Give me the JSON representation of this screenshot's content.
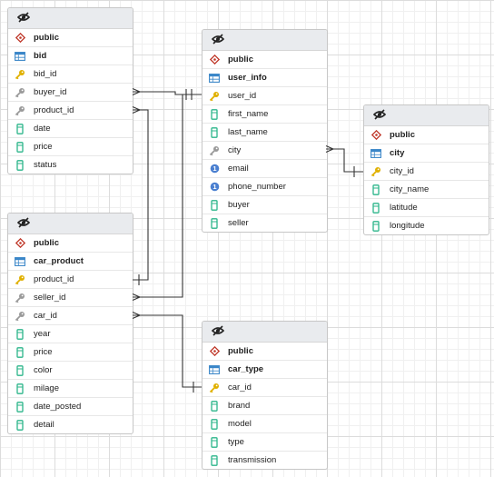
{
  "tables": {
    "bid": {
      "schema": "public",
      "name": "bid",
      "columns": [
        {
          "name": "bid_id",
          "icon": "primary-key-icon"
        },
        {
          "name": "buyer_id",
          "icon": "foreign-key-icon"
        },
        {
          "name": "product_id",
          "icon": "foreign-key-icon"
        },
        {
          "name": "date",
          "icon": "column-icon"
        },
        {
          "name": "price",
          "icon": "column-icon"
        },
        {
          "name": "status",
          "icon": "column-icon"
        }
      ]
    },
    "user_info": {
      "schema": "public",
      "name": "user_info",
      "columns": [
        {
          "name": "user_id",
          "icon": "primary-key-icon"
        },
        {
          "name": "first_name",
          "icon": "column-icon"
        },
        {
          "name": "last_name",
          "icon": "column-icon"
        },
        {
          "name": "city",
          "icon": "foreign-key-icon"
        },
        {
          "name": "email",
          "icon": "unique-index-icon"
        },
        {
          "name": "phone_number",
          "icon": "unique-index-icon"
        },
        {
          "name": "buyer",
          "icon": "column-icon"
        },
        {
          "name": "seller",
          "icon": "column-icon"
        }
      ]
    },
    "city": {
      "schema": "public",
      "name": "city",
      "columns": [
        {
          "name": "city_id",
          "icon": "primary-key-icon"
        },
        {
          "name": "city_name",
          "icon": "column-icon"
        },
        {
          "name": "latitude",
          "icon": "column-icon"
        },
        {
          "name": "longitude",
          "icon": "column-icon"
        }
      ]
    },
    "car_product": {
      "schema": "public",
      "name": "car_product",
      "columns": [
        {
          "name": "product_id",
          "icon": "primary-key-icon"
        },
        {
          "name": "seller_id",
          "icon": "foreign-key-icon"
        },
        {
          "name": "car_id",
          "icon": "foreign-key-icon"
        },
        {
          "name": "year",
          "icon": "column-icon"
        },
        {
          "name": "price",
          "icon": "column-icon"
        },
        {
          "name": "color",
          "icon": "column-icon"
        },
        {
          "name": "milage",
          "icon": "column-icon"
        },
        {
          "name": "date_posted",
          "icon": "column-icon"
        },
        {
          "name": "detail",
          "icon": "column-icon"
        }
      ]
    },
    "car_type": {
      "schema": "public",
      "name": "car_type",
      "columns": [
        {
          "name": "car_id",
          "icon": "primary-key-icon"
        },
        {
          "name": "brand",
          "icon": "column-icon"
        },
        {
          "name": "model",
          "icon": "column-icon"
        },
        {
          "name": "type",
          "icon": "column-icon"
        },
        {
          "name": "transmission",
          "icon": "column-icon"
        }
      ]
    }
  },
  "colors": {
    "schema_icon": "#c0392b",
    "table_icon": "#3a86c8",
    "primary_key": "#e0b000",
    "foreign_key": "#9a9a9a",
    "column": "#2bb58a",
    "unique_index": "#4a7fd0",
    "line": "#333333"
  }
}
